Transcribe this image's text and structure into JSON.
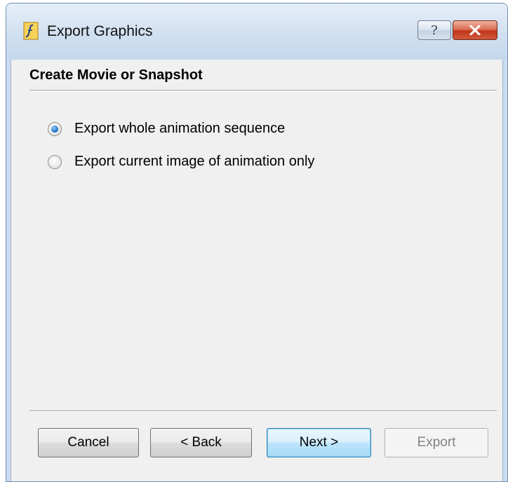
{
  "window": {
    "title": "Export Graphics",
    "help_label": "?",
    "close_icon": "close-x-icon",
    "app_icon": "function-f-icon"
  },
  "header": {
    "title": "Create Movie or Snapshot"
  },
  "options": [
    {
      "label": "Export whole animation sequence",
      "checked": true
    },
    {
      "label": "Export current image of animation only",
      "checked": false
    }
  ],
  "buttons": {
    "cancel": "Cancel",
    "back": "< Back",
    "next": "Next >",
    "export": "Export"
  },
  "colors": {
    "close_button": "#c2371c",
    "radio_selected": "#2b7bc9",
    "default_button_border": "#3c7fb1"
  }
}
